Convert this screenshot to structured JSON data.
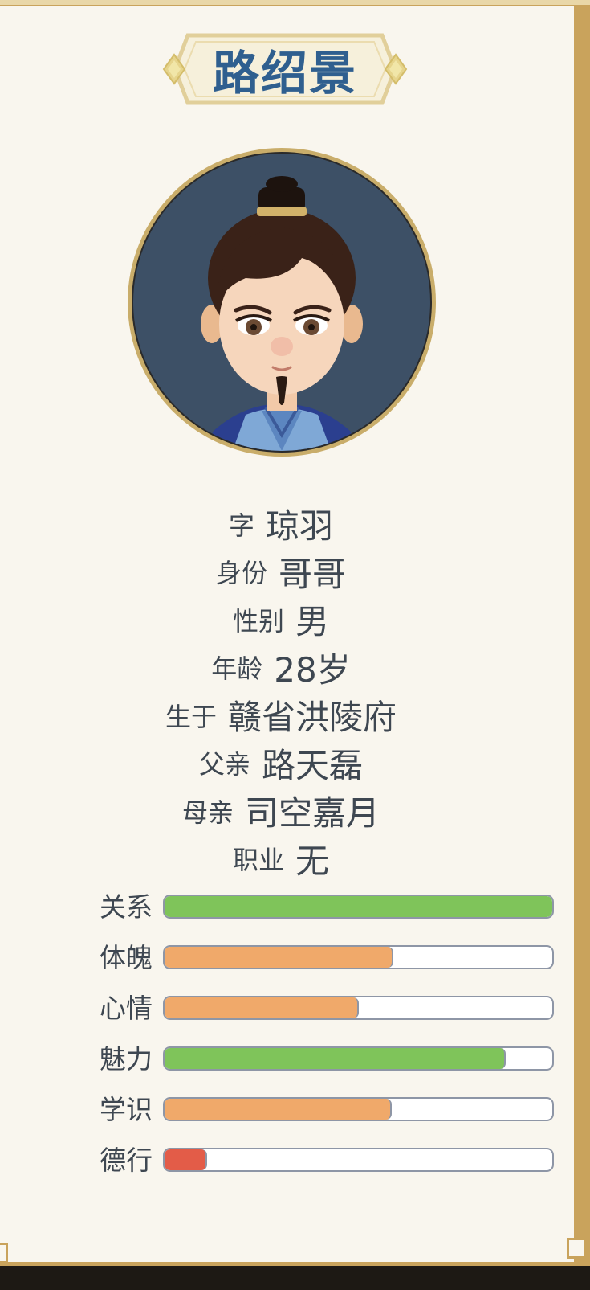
{
  "character": {
    "name": "路绍景"
  },
  "info": [
    {
      "label": "字",
      "value": "琼羽"
    },
    {
      "label": "身份",
      "value": "哥哥"
    },
    {
      "label": "性别",
      "value": "男"
    },
    {
      "label": "年龄",
      "value": "28岁"
    },
    {
      "label": "生于",
      "value": "赣省洪陵府"
    },
    {
      "label": "父亲",
      "value": "路天磊"
    },
    {
      "label": "母亲",
      "value": "司空嘉月"
    },
    {
      "label": "职业",
      "value": "无"
    }
  ],
  "stats": [
    {
      "label": "关系",
      "level": 1.0,
      "color": "#7fc45a"
    },
    {
      "label": "体魄",
      "level": 0.59,
      "color": "#f0a96a"
    },
    {
      "label": "心情",
      "level": 0.5,
      "color": "#f0a96a"
    },
    {
      "label": "魅力",
      "level": 0.88,
      "color": "#7fc45a"
    },
    {
      "label": "学识",
      "level": 0.585,
      "color": "#f0a96a"
    },
    {
      "label": "德行",
      "level": 0.11,
      "color": "#e35c48"
    }
  ],
  "colors": {
    "title_text": "#2f5f8f",
    "frame_gold": "#c9a35c",
    "panel_bg": "#f9f6ee",
    "avatar_bg": "#3d5066"
  },
  "icons": {
    "avatar": "character-portrait"
  }
}
